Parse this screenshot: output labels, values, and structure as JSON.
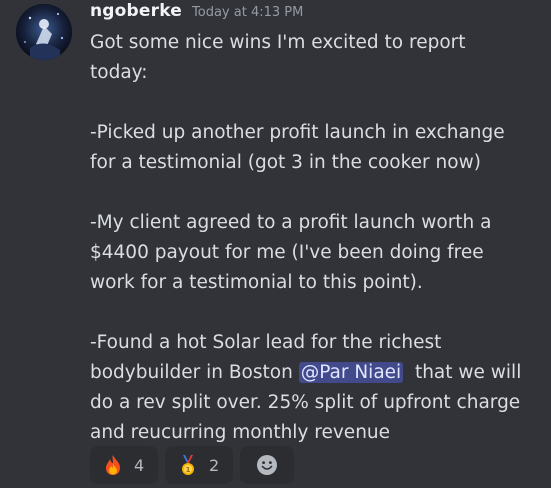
{
  "message": {
    "username": "ngoberke",
    "timestamp": "Today at 4:13 PM",
    "paragraphs": {
      "p1": "Got some nice wins I'm excited to report\ntoday:",
      "p2": "-Picked up another profit launch in exchange\nfor a testimonial (got 3 in the cooker now)",
      "p3": "-My client agreed to a profit launch worth a\n$4400 payout for me (I've been doing free\nwork for a testimonial to this point).",
      "p4_before": "-Found a hot Solar lead for the richest\nbodybuilder in Boston ",
      "p4_mention": "@Par Niaei",
      "p4_after": "  that we will\ndo a rev split over. 25% split of upfront charge\nand reucurring monthly revenue"
    }
  },
  "reactions": [
    {
      "icon": "fire-emoji-icon",
      "count": "4"
    },
    {
      "icon": "medal-emoji-icon",
      "count": "2"
    }
  ],
  "add_reaction_icon": "smiley-face-icon",
  "colors": {
    "background": "#313338",
    "mention_bg": "#5865f2",
    "username": "#f2f3f5",
    "timestamp": "#949ba4",
    "reaction_bg": "#2b2d31"
  }
}
